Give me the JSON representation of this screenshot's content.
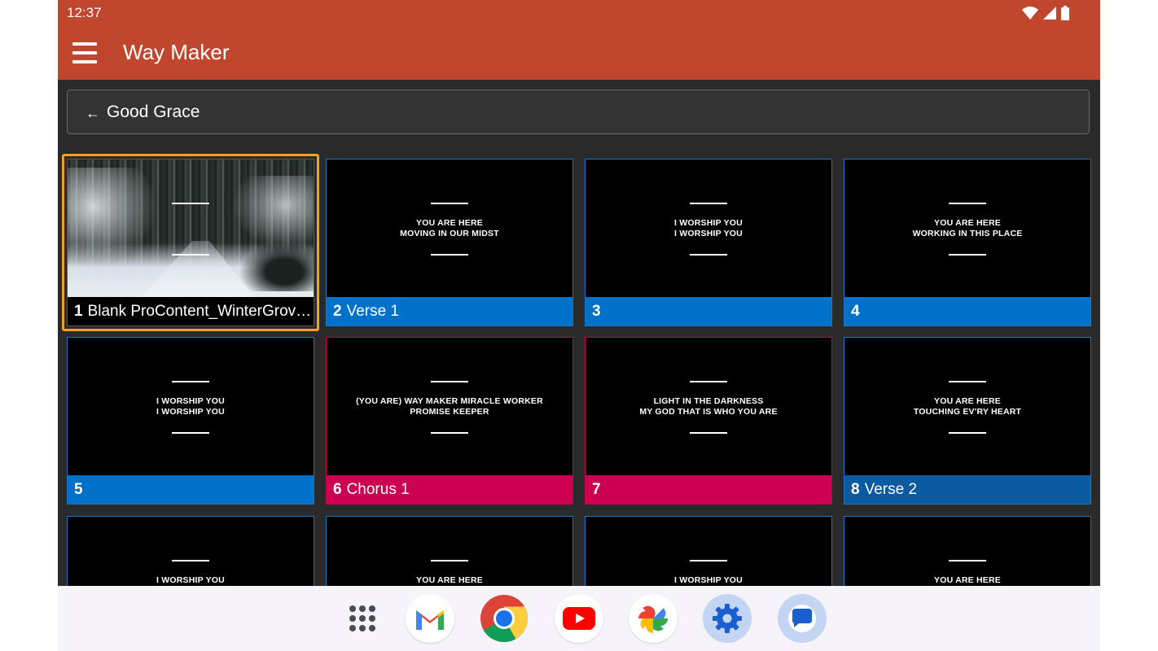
{
  "status_bar": {
    "time": "12:37"
  },
  "app_bar": {
    "title": "Way Maker"
  },
  "breadcrumb": {
    "arrow": "←",
    "label": "Good Grace"
  },
  "slides": [
    {
      "number": "1",
      "label": "Blank  ProContent_WinterGrove…",
      "lyrics": ""
    },
    {
      "number": "2",
      "label": "Verse 1",
      "lyrics": "YOU ARE HERE\nMOVING IN OUR MIDST"
    },
    {
      "number": "3",
      "label": "",
      "lyrics": "I WORSHIP YOU\nI WORSHIP YOU"
    },
    {
      "number": "4",
      "label": "",
      "lyrics": "YOU ARE HERE\nWORKING IN THIS PLACE"
    },
    {
      "number": "5",
      "label": "",
      "lyrics": "I WORSHIP YOU\nI WORSHIP YOU"
    },
    {
      "number": "6",
      "label": "Chorus 1",
      "lyrics": "(YOU ARE) WAY MAKER MIRACLE WORKER\nPROMISE KEEPER"
    },
    {
      "number": "7",
      "label": "",
      "lyrics": "LIGHT IN THE DARKNESS\nMY GOD THAT IS WHO YOU ARE"
    },
    {
      "number": "8",
      "label": "Verse 2",
      "lyrics": "YOU ARE HERE\nTOUCHING EV'RY HEART"
    },
    {
      "number": "",
      "label": "",
      "lyrics": "I WORSHIP YOU"
    },
    {
      "number": "",
      "label": "",
      "lyrics": "YOU ARE HERE"
    },
    {
      "number": "",
      "label": "",
      "lyrics": "I WORSHIP YOU"
    },
    {
      "number": "",
      "label": "",
      "lyrics": "YOU ARE HERE"
    }
  ],
  "colors": {
    "app_bar": "#c0462e",
    "verse_group": "#0071c9",
    "chorus_group": "#cc0050",
    "verse2_group": "#0a5aa0",
    "selection": "#f5a11c"
  },
  "dock": [
    {
      "icon": "app-drawer-icon"
    },
    {
      "icon": "gmail-icon"
    },
    {
      "icon": "chrome-icon"
    },
    {
      "icon": "youtube-icon"
    },
    {
      "icon": "photos-icon"
    },
    {
      "icon": "settings-icon"
    },
    {
      "icon": "messages-icon"
    }
  ]
}
